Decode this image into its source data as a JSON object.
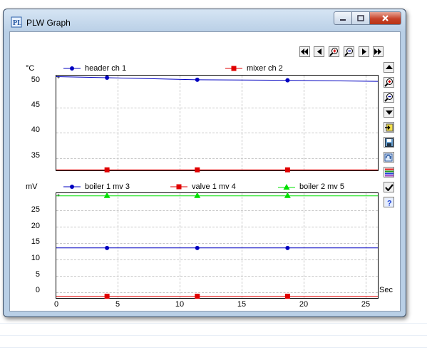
{
  "window": {
    "title": "PLW Graph",
    "app_icon": "plw-logo-icon",
    "controls": [
      "minimize-icon",
      "maximize-icon",
      "close-icon"
    ]
  },
  "toolbar_top": [
    "first-page-icon",
    "previous-icon",
    "zoom-in-icon",
    "zoom-out-icon",
    "next-icon",
    "last-page-icon"
  ],
  "toolbar_side": [
    "scroll-up-icon",
    "zoom-in-vertical-icon",
    "zoom-out-vertical-icon",
    "scroll-down-icon",
    "export-icon",
    "save-icon",
    "refresh-icon",
    "color-settings-icon",
    "check-icon",
    "help-icon"
  ],
  "colors": {
    "blue": "#0000c0",
    "red": "#e00000",
    "green": "#00e000"
  },
  "chart_data": [
    {
      "type": "line",
      "ylabel": "°C",
      "ylim": [
        33,
        51
      ],
      "yticks": [
        "50",
        "45",
        "40",
        "35"
      ],
      "xlim": [
        0,
        26
      ],
      "grid": true,
      "legend": "top",
      "series": [
        {
          "name": "header ch 1",
          "color": "#0000c0",
          "marker": "circle",
          "x": [
            0,
            4.1,
            11.4,
            18.7,
            26
          ],
          "values": [
            50.8,
            50.6,
            50.2,
            50.1,
            49.9
          ]
        },
        {
          "name": "mixer ch 2",
          "color": "#e00000",
          "marker": "square",
          "x": [
            0,
            4.1,
            11.4,
            18.7,
            26
          ],
          "values": [
            33.1,
            33.1,
            33.1,
            33.1,
            33.1
          ]
        }
      ]
    },
    {
      "type": "line",
      "ylabel": "mV",
      "ylim": [
        -1,
        30
      ],
      "yticks": [
        "25",
        "20",
        "15",
        "10",
        "5",
        "0"
      ],
      "xlim": [
        0,
        26
      ],
      "xticks": [
        "0",
        "5",
        "10",
        "15",
        "20",
        "25"
      ],
      "xlabel": "Sec",
      "grid": true,
      "legend": "top",
      "series": [
        {
          "name": "boiler 1  mv 3",
          "color": "#0000c0",
          "marker": "circle",
          "x": [
            0,
            4.1,
            11.4,
            18.7,
            26
          ],
          "values": [
            13.8,
            13.8,
            13.8,
            13.8,
            13.8
          ]
        },
        {
          "name": "valve 1 mv  4",
          "color": "#e00000",
          "marker": "square",
          "x": [
            0,
            4.1,
            11.4,
            18.7,
            26
          ],
          "values": [
            -0.5,
            -0.5,
            -0.5,
            -0.5,
            -0.5
          ]
        },
        {
          "name": "boiler 2  mv 5",
          "color": "#00e000",
          "marker": "triangle",
          "x": [
            0,
            4.1,
            11.4,
            18.7,
            26
          ],
          "values": [
            29.2,
            29.2,
            29.2,
            29.2,
            29.2
          ]
        }
      ]
    }
  ]
}
